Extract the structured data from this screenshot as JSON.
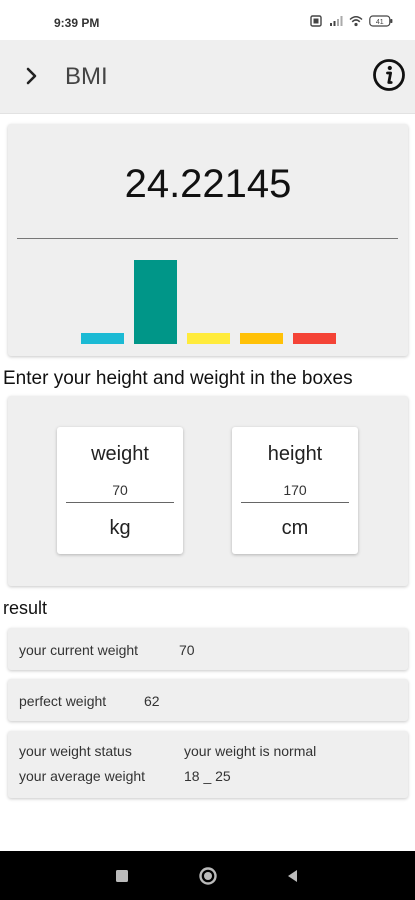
{
  "status": {
    "time": "9:39 PM",
    "battery": "41"
  },
  "appbar": {
    "title": "BMI"
  },
  "bmi": {
    "value": "24.22145",
    "scale": [
      {
        "color": "#1bbad4",
        "level": 0.12
      },
      {
        "color": "#009688",
        "level": 0.91
      },
      {
        "color": "#ffeb3b",
        "level": 0.12
      },
      {
        "color": "#ffc107",
        "level": 0.12
      },
      {
        "color": "#f44336",
        "level": 0.12
      }
    ],
    "active_index": 1
  },
  "prompt": "Enter your height and weight in the boxes",
  "inputs": {
    "weight": {
      "label": "weight",
      "value": "70",
      "unit": "kg"
    },
    "height": {
      "label": "height",
      "value": "170",
      "unit": "cm"
    }
  },
  "result": {
    "label": "result",
    "current_weight_label": "your current weight",
    "current_weight_value": "70",
    "perfect_weight_label": "perfect weight",
    "perfect_weight_value": "62",
    "status_label": "your weight status",
    "status_value": "your weight is normal",
    "average_label": "your average weight",
    "average_value": "18 _ 25"
  },
  "icons": {
    "back": "chevron-right-icon",
    "info": "info-icon",
    "nav": [
      "recent-apps-icon",
      "home-icon",
      "back-icon"
    ]
  }
}
